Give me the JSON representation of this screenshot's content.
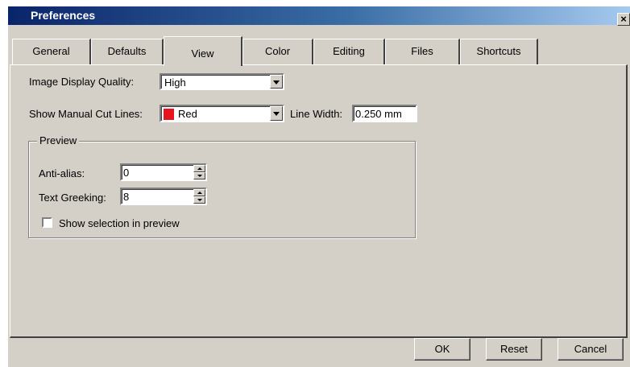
{
  "window": {
    "title": "Preferences",
    "close_label": "×"
  },
  "tabs": [
    {
      "label": "General"
    },
    {
      "label": "Defaults"
    },
    {
      "label": "View",
      "active": true
    },
    {
      "label": "Color"
    },
    {
      "label": "Editing"
    },
    {
      "label": "Files"
    },
    {
      "label": "Shortcuts"
    }
  ],
  "view": {
    "image_quality_label": "Image Display Quality:",
    "image_quality_value": "High",
    "cut_lines_label": "Show Manual Cut Lines:",
    "cut_lines_value": "Red",
    "cut_lines_color": "#e8131f",
    "line_width_label": "Line Width:",
    "line_width_value": "0.250 mm"
  },
  "preview": {
    "group_label": "Preview",
    "antialias_label": "Anti-alias:",
    "antialias_value": "0",
    "greeking_label": "Text Greeking:",
    "greeking_value": "8",
    "show_selection_label": "Show selection in preview",
    "show_selection_checked": false
  },
  "buttons": {
    "ok": "OK",
    "reset": "Reset",
    "cancel": "Cancel"
  }
}
